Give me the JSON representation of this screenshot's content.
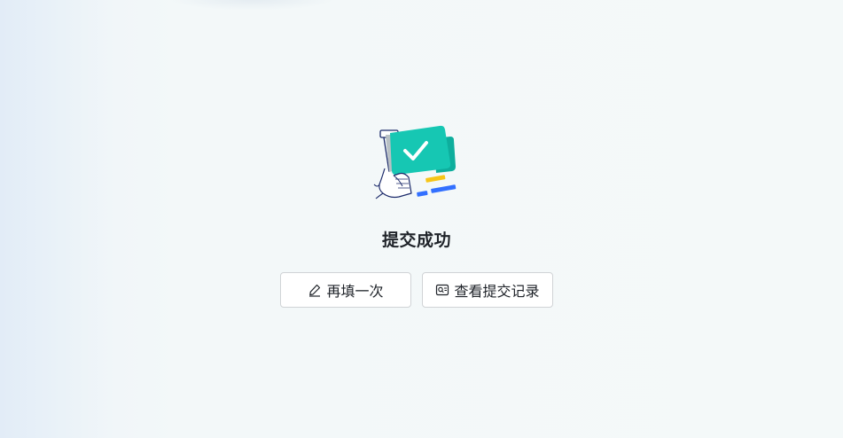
{
  "result": {
    "title": "提交成功",
    "illustration_icon": "success-hand-checkmark-illustration",
    "accent_color": "#16c7b3",
    "actions": [
      {
        "label": "再填一次",
        "icon": "edit-icon"
      },
      {
        "label": "查看提交记录",
        "icon": "search-record-icon"
      }
    ]
  }
}
